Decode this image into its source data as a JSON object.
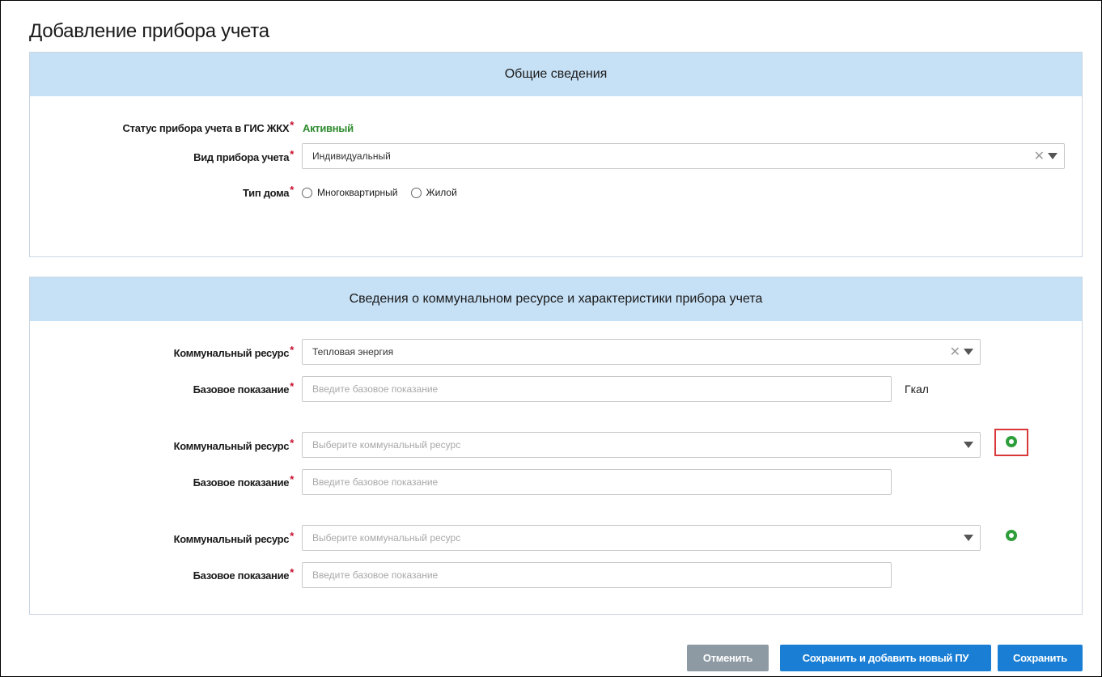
{
  "page_title": "Добавление прибора учета",
  "general": {
    "header": "Общие сведения",
    "status_label": "Статус прибора учета в ГИС ЖКХ",
    "status_value": "Активный",
    "device_type_label": "Вид прибора учета",
    "device_type_value": "Индивидуальный",
    "house_type_label": "Тип дома",
    "house_type_options": [
      "Многоквартирный",
      "Жилой"
    ]
  },
  "resource": {
    "header": "Сведения о коммунальном ресурсе и характеристики прибора учета",
    "resource_label": "Коммунальный ресурс",
    "reading_label": "Базовое показание",
    "resource_placeholder": "Выберите коммунальный ресурс",
    "reading_placeholder": "Введите базовое показание",
    "rows": [
      {
        "resource": "Тепловая энергия",
        "unit": "Гкал"
      },
      {
        "resource": "",
        "unit": ""
      },
      {
        "resource": "",
        "unit": ""
      }
    ]
  },
  "buttons": {
    "cancel": "Отменить",
    "save_and_add": "Сохранить и добавить новый ПУ",
    "save": "Сохранить"
  },
  "colors": {
    "header_bg": "#c6e0f5",
    "status_green": "#2e8b2e",
    "primary_blue": "#1a7fd4",
    "cancel_gray": "#8e9aa3",
    "add_green": "#2e9e3a",
    "highlight_red": "#d9383a"
  }
}
